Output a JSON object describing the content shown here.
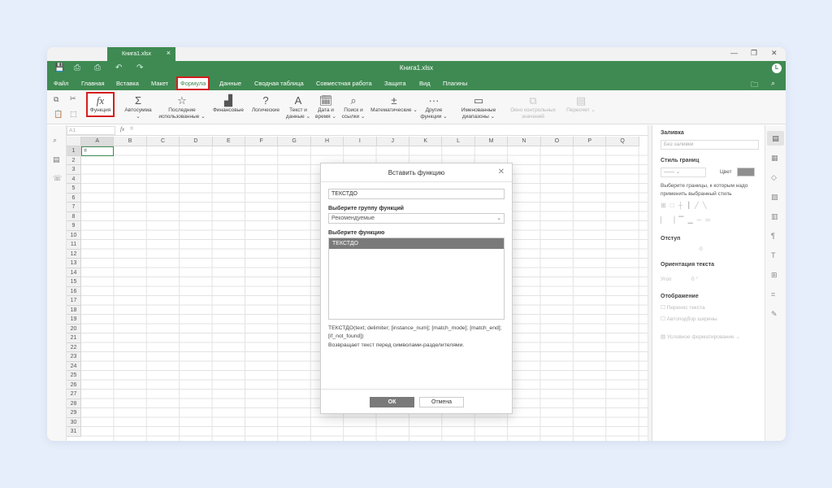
{
  "tab": {
    "name": "Книга1.xlsx",
    "close": "×"
  },
  "window": {
    "title": "Книга1.xlsx",
    "minimize": "—",
    "restore": "❐",
    "close": "✕",
    "user_initial": "L"
  },
  "menu": [
    "Файл",
    "Главная",
    "Вставка",
    "Макет",
    "Формула",
    "Данные",
    "Сводная таблица",
    "Совместная работа",
    "Защита",
    "Вид",
    "Плагины"
  ],
  "active_menu": "Формула",
  "ribbon": [
    {
      "label": "Функция",
      "icon": "fx"
    },
    {
      "label": "Автосумма",
      "icon": "Σ"
    },
    {
      "label": "Последние использованные",
      "icon": "☆"
    },
    {
      "label": "Финансовые",
      "icon": "▟"
    },
    {
      "label": "Логические",
      "icon": "?"
    },
    {
      "label": "Текст и данные",
      "icon": "A"
    },
    {
      "label": "Дата и время",
      "icon": "🗓"
    },
    {
      "label": "Поиск и ссылки",
      "icon": "⌕"
    },
    {
      "label": "Математические",
      "icon": "±"
    },
    {
      "label": "Другие функции",
      "icon": "···"
    },
    {
      "label": "Именованные диапазоны",
      "icon": "▭"
    },
    {
      "label": "Окно контрольных значений",
      "icon": "⧉"
    },
    {
      "label": "Пересчет",
      "icon": "▤"
    }
  ],
  "formula_bar": {
    "cell_ref": "A1",
    "fx": "fx",
    "value": "="
  },
  "sheet": {
    "columns": [
      "A",
      "B",
      "C",
      "D",
      "E",
      "F",
      "G",
      "H",
      "I",
      "J",
      "K",
      "L",
      "M",
      "N",
      "O",
      "P",
      "Q"
    ],
    "rows": [
      "1",
      "2",
      "3",
      "4",
      "5",
      "6",
      "7",
      "8",
      "9",
      "10",
      "11",
      "12",
      "13",
      "14",
      "15",
      "16",
      "17",
      "18",
      "19",
      "20",
      "21",
      "22",
      "23",
      "24",
      "25",
      "26",
      "27",
      "28",
      "29",
      "30",
      "31"
    ],
    "active_cell_value": "="
  },
  "dialog": {
    "title": "Вставить функцию",
    "search_value": "ТЕКСТДО",
    "group_label": "Выберите группу функций",
    "group_value": "Рекомендуемые",
    "function_label": "Выберите функцию",
    "functions": [
      "ТЕКСТДО"
    ],
    "syntax": "ТЕКСТДО(text; delimiter; [instance_num]; [match_mode]; [match_end]; [if_not_found])",
    "description": "Возвращает текст перед символами-разделителями.",
    "ok": "ОК",
    "cancel": "Отмена"
  },
  "right_panel": {
    "fill_label": "Заливка",
    "fill_value": "Без заливки",
    "border_style_label": "Стиль границ",
    "color_label": "Цвет",
    "border_hint": "Выберите границы, к которым надо применить выбранный стиль",
    "indent_label": "Отступ",
    "indent_value": "0",
    "orientation_label": "Ориентация текста",
    "angle_label": "Угол",
    "angle_value": "0 °",
    "display_label": "Отображение",
    "wrap_text": "Перенос текста",
    "autofit_width": "Автоподбор ширины",
    "conditional_formatting": "Условное форматирование"
  }
}
